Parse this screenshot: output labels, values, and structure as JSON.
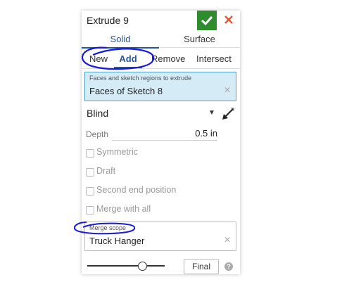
{
  "dialog": {
    "title": "Extrude 9",
    "ok_icon": "checkmark-icon",
    "close_icon": "close-icon",
    "accent_ok": "#2e8b2e",
    "accent_close": "#e05a3a"
  },
  "type_tabs": [
    {
      "label": "Solid",
      "selected": true
    },
    {
      "label": "Surface",
      "selected": false
    }
  ],
  "operation_tabs": [
    {
      "label": "New",
      "selected": false
    },
    {
      "label": "Add",
      "selected": true
    },
    {
      "label": "Remove",
      "selected": false
    },
    {
      "label": "Intersect",
      "selected": false
    }
  ],
  "faces_field": {
    "label": "Faces and sketch regions to extrude",
    "value": "Faces of Sketch 8",
    "clear_icon": "clear-icon"
  },
  "end_type": {
    "value": "Blind",
    "caret_icon": "dropdown-caret-icon",
    "flip_icon": "flip-direction-icon"
  },
  "depth": {
    "label": "Depth",
    "value": "0.5 in"
  },
  "options": [
    {
      "label": "Symmetric",
      "checked": false
    },
    {
      "label": "Draft",
      "checked": false
    },
    {
      "label": "Second end position",
      "checked": false
    },
    {
      "label": "Merge with all",
      "checked": false
    }
  ],
  "merge_scope": {
    "label": "Merge scope",
    "value": "Truck Hanger",
    "clear_icon": "clear-icon"
  },
  "footer": {
    "slider_value": 0.7,
    "final_label": "Final",
    "help_label": "?"
  },
  "colors": {
    "accent": "#2456a6",
    "active_field": "#d5ecf7",
    "annotation": "#1a1adc"
  }
}
